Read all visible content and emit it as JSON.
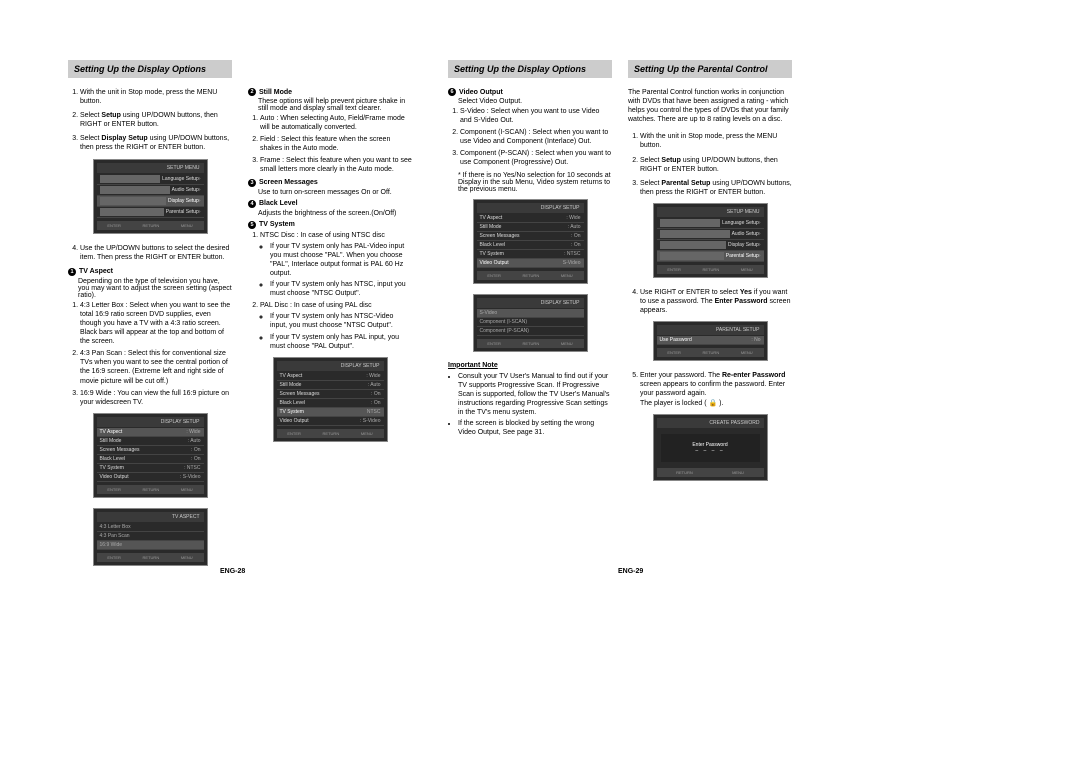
{
  "headings": {
    "h1": "Setting Up the Display Options",
    "h2": "Setting Up the Display Options",
    "h3": "Setting Up the Parental Control"
  },
  "col1": {
    "step1": "With the unit in Stop mode, press the MENU button.",
    "step2_a": "Select ",
    "step2_b": "Setup",
    "step2_c": " using UP/DOWN buttons, then RIGHT or ENTER button.",
    "step3_a": "Select ",
    "step3_b": "Display Setup",
    "step3_c": " using UP/DOWN buttons, then press the RIGHT or ENTER button.",
    "step4": "Use the UP/DOWN buttons to select the desired item. Then press the RIGHT or ENTER button.",
    "tva_num": "1",
    "tva_label": "TV Aspect",
    "tva_desc": "Depending on the type of television you have, you may want to adjust the screen setting (aspect ratio).",
    "tva_1": "4:3 Letter Box : Select when you want to see the total 16:9 ratio screen DVD supplies, even though you have a TV with a 4:3 ratio screen. Black bars will appear at the top and bottom of the screen.",
    "tva_2": "4:3 Pan Scan : Select this for conventional size TVs when you want to see the central portion of the 16:9 screen. (Extreme left and right side of movie picture will be cut off.)",
    "tva_3": "16:9 Wide : You can view the full 16:9 picture on your widescreen TV."
  },
  "col2": {
    "sm_num": "2",
    "sm_label": "Still Mode",
    "sm_desc": "These options will help prevent picture shake in still mode and display small text clearer.",
    "sm_1": "Auto : When selecting Auto, Field/Frame mode will be automatically converted.",
    "sm_2": "Field : Select this feature when the screen shakes in the Auto mode.",
    "sm_3": "Frame : Select this feature when you want to see small letters more clearly in the Auto mode.",
    "scm_num": "3",
    "scm_label": "Screen Messages",
    "scm_desc": "Use to turn on-screen messages On or Off.",
    "bl_num": "4",
    "bl_label": "Black Level",
    "bl_desc": "Adjusts the brightness of the screen.(On/Off)",
    "tvs_num": "5",
    "tvs_label": "TV System",
    "tvs_1": "NTSC Disc : In case of using NTSC disc",
    "tvs_1a": "If your TV system only has PAL-Video input you must choose \"PAL\". When you choose \"PAL\", Interlace output format is PAL 60 Hz output.",
    "tvs_1b": "If your TV system only has NTSC, input you must choose \"NTSC Output\".",
    "tvs_2": "PAL Disc : In case of using PAL disc",
    "tvs_2a": "If your TV system only has NTSC-Video input, you must choose \"NTSC Output\".",
    "tvs_2b": "If your TV system only has PAL input, you must choose \"PAL Output\"."
  },
  "col3": {
    "vo_num": "6",
    "vo_label": "Video Output",
    "vo_desc": "Select Video Output.",
    "vo_1": "S-Video : Select when you want to use Video and S-Video Out.",
    "vo_2": "Component (I-SCAN) : Select when you want to use Video and Component (Interlace) Out.",
    "vo_3": "Component (P-SCAN) : Select when you want to use Component (Progressive) Out.",
    "vo_note": "* If there is no Yes/No selection for 10 seconds at Display in the sub Menu, Video system returns to the previous menu.",
    "imp_title": "Important Note",
    "imp_1": "Consult your TV User's Manual to find out if your TV supports Progressive Scan. If Progressive Scan is supported, follow the TV User's Manual's instructions regarding Progressive Scan settings in the TV's menu system.",
    "imp_2": "If the screen is blocked by setting the wrong Video Output, See page 31."
  },
  "col4": {
    "intro": "The Parental Control function works in conjunction with DVDs that have been assigned a rating - which helps you control the types of DVDs that your family watches. There are up to 8 rating levels on a disc.",
    "step1": "With the unit in Stop mode, press the MENU button.",
    "step2_a": "Select ",
    "step2_b": "Setup",
    "step2_c": " using UP/DOWN buttons, then RIGHT or ENTER button.",
    "step3_a": "Select ",
    "step3_b": "Parental Setup",
    "step3_c": " using UP/DOWN buttons, then press the RIGHT or ENTER button.",
    "step4_a": "Use RIGHT or ENTER to select ",
    "step4_b": "Yes",
    "step4_c": " if you want to use a password. The ",
    "step4_d": "Enter Password",
    "step4_e": " screen appears.",
    "step5_a": "Enter your password. The ",
    "step5_b": "Re-enter Password",
    "step5_c": " screen appears to confirm the password. Enter your password again.",
    "step5_d": "The player is locked ( 🔒 )."
  },
  "scr": {
    "setup_menu": {
      "title": "SETUP MENU",
      "r1": "Language Setup",
      "r2": "Audio Setup",
      "r3": "Display Setup",
      "r4": "Parental Setup"
    },
    "display_setup": {
      "title": "DISPLAY SETUP",
      "r1l": "TV Aspect",
      "r1r": ": Wide",
      "r2l": "Still Mode",
      "r2r": ": Auto",
      "r3l": "Screen Messages",
      "r3r": ": On",
      "r4l": "Black Level",
      "r4r": ": On",
      "r5l": "TV System",
      "r5r": ": NTSC",
      "r6l": "Video Output",
      "r6r": ": S-Video"
    },
    "tv_aspect": {
      "title": "TV ASPECT",
      "r1": "4:3 Letter Box",
      "r2": "4:3 Pan Scan",
      "r3": "16:9 Wide"
    },
    "tv_system": {
      "title": "DISPLAY SETUP",
      "r1l": "TV Aspect",
      "r1r": ": Wide",
      "r2l": "Still Mode",
      "r2r": ": Auto",
      "r3l": "Screen Messages",
      "r3r": ": On",
      "r4l": "Black Level",
      "r4r": ": On",
      "r5l": "TV System",
      "r5r": "NTSC",
      "r6l": "Video Output",
      "r6r": ": S-Video"
    },
    "video_out": {
      "title": "DISPLAY SETUP",
      "r1l": "TV Aspect",
      "r1r": ": Wide",
      "r2l": "Still Mode",
      "r2r": ": Auto",
      "r3l": "Screen Messages",
      "r3r": ": On",
      "r4l": "Black Level",
      "r4r": ": On",
      "r5l": "TV System",
      "r5r": ": NTSC",
      "r6l": "Video Output",
      "r6r": "S-Video"
    },
    "video_out2": {
      "title": "DISPLAY SETUP",
      "r1": "S-Video",
      "r2": "Component (I-SCAN)",
      "r3": "Component (P-SCAN)"
    },
    "parental_menu": {
      "title": "SETUP MENU",
      "r1": "Language Setup",
      "r2": "Audio Setup",
      "r3": "Display Setup",
      "r4": "Parental Setup"
    },
    "parental_setup": {
      "title": "PARENTAL SETUP",
      "r1l": "Use Password",
      "r1r": ": No"
    },
    "create_pw": {
      "title": "CREATE PASSWORD",
      "label": "Enter Password"
    },
    "btn_enter": "ENTER",
    "btn_return": "RETURN",
    "btn_menu": "MENU"
  },
  "footer": {
    "left": "ENG-28",
    "right": "ENG-29"
  }
}
